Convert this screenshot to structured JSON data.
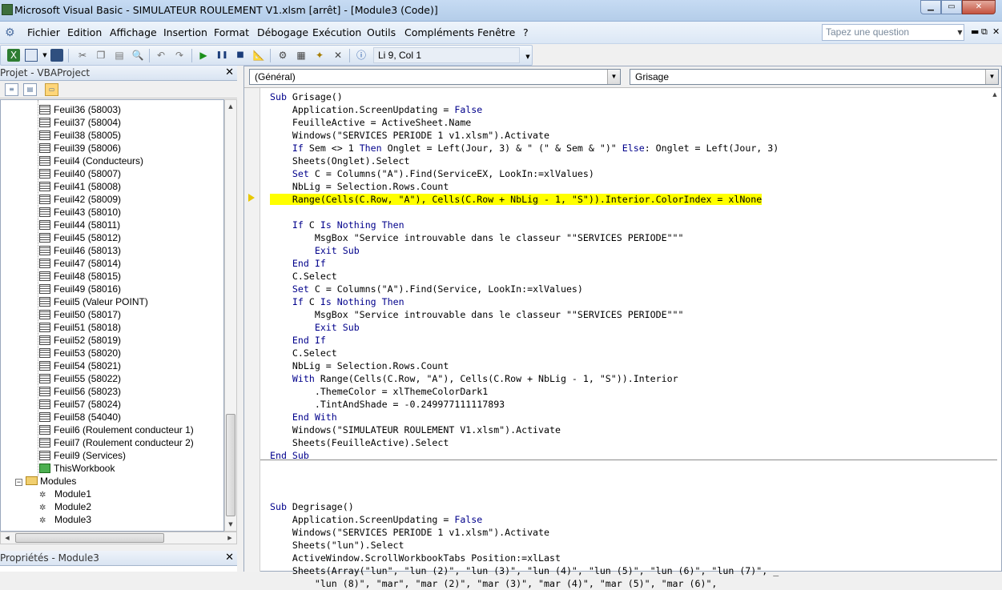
{
  "window": {
    "title": "Microsoft Visual Basic - SIMULATEUR ROULEMENT V1.xlsm [arrêt] - [Module3 (Code)]",
    "min_glyph": "▁",
    "max_glyph": "▭",
    "close_glyph": "✕"
  },
  "menu": {
    "items": [
      "Fichier",
      "Edition",
      "Affichage",
      "Insertion",
      "Format",
      "Débogage",
      "Exécution",
      "Outils",
      "Compléments",
      "Fenêtre",
      "?"
    ],
    "ask_placeholder": "Tapez une question",
    "mdi_min": "▬",
    "mdi_restore": "⧉",
    "mdi_close": "✕"
  },
  "toolbar": {
    "position_label": "Li 9, Col 1",
    "icons": [
      "excel-icon",
      "insert-userform-icon",
      "save-icon",
      "cut-icon",
      "copy-icon",
      "paste-icon",
      "find-icon",
      "undo-icon",
      "redo-icon",
      "run-icon",
      "break-icon",
      "reset-icon",
      "design-mode-icon",
      "project-explorer-icon",
      "properties-icon",
      "object-browser-icon",
      "toolbox-icon",
      "help-icon"
    ]
  },
  "project_panel": {
    "title": "Projet - VBAProject",
    "close_label": "✕",
    "sheets": [
      "Feuil36 (58003)",
      "Feuil37 (58004)",
      "Feuil38 (58005)",
      "Feuil39 (58006)",
      "Feuil4 (Conducteurs)",
      "Feuil40 (58007)",
      "Feuil41 (58008)",
      "Feuil42 (58009)",
      "Feuil43 (58010)",
      "Feuil44 (58011)",
      "Feuil45 (58012)",
      "Feuil46 (58013)",
      "Feuil47 (58014)",
      "Feuil48 (58015)",
      "Feuil49 (58016)",
      "Feuil5 (Valeur POINT)",
      "Feuil50 (58017)",
      "Feuil51 (58018)",
      "Feuil52 (58019)",
      "Feuil53 (58020)",
      "Feuil54 (58021)",
      "Feuil55 (58022)",
      "Feuil56 (58023)",
      "Feuil57 (58024)",
      "Feuil58 (54040)",
      "Feuil6 (Roulement conducteur 1)",
      "Feuil7 (Roulement conducteur 2)",
      "Feuil9 (Services)"
    ],
    "workbook": "ThisWorkbook",
    "modules_folder": "Modules",
    "modules": [
      "Module1",
      "Module2",
      "Module3"
    ]
  },
  "properties_panel": {
    "title": "Propriétés - Module3",
    "close_label": "✕"
  },
  "code_window": {
    "object_combo": "(Général)",
    "procedure_combo": "Grisage",
    "highlighted_line_index": 8,
    "lines": [
      "Sub Grisage()",
      "    Application.ScreenUpdating = False",
      "    FeuilleActive = ActiveSheet.Name",
      "    Windows(\"SERVICES PERIODE 1 v1.xlsm\").Activate",
      "    If Sem <> 1 Then Onglet = Left(Jour, 3) & \" (\" & Sem & \")\" Else: Onglet = Left(Jour, 3)",
      "    Sheets(Onglet).Select",
      "    Set C = Columns(\"A\").Find(ServiceEX, LookIn:=xlValues)",
      "    NbLig = Selection.Rows.Count",
      "    Range(Cells(C.Row, \"A\"), Cells(C.Row + NbLig - 1, \"S\")).Interior.ColorIndex = xlNone",
      "",
      "    If C Is Nothing Then",
      "        MsgBox \"Service introuvable dans le classeur \"\"SERVICES PERIODE\"\"\"",
      "        Exit Sub",
      "    End If",
      "    C.Select",
      "    Set C = Columns(\"A\").Find(Service, LookIn:=xlValues)",
      "    If C Is Nothing Then",
      "        MsgBox \"Service introuvable dans le classeur \"\"SERVICES PERIODE\"\"\"",
      "        Exit Sub",
      "    End If",
      "    C.Select",
      "    NbLig = Selection.Rows.Count",
      "    With Range(Cells(C.Row, \"A\"), Cells(C.Row + NbLig - 1, \"S\")).Interior",
      "        .ThemeColor = xlThemeColorDark1",
      "        .TintAndShade = -0.249977111117893",
      "    End With",
      "    Windows(\"SIMULATEUR ROULEMENT V1.xlsm\").Activate",
      "    Sheets(FeuilleActive).Select",
      "End Sub",
      "",
      "",
      "",
      "Sub Degrisage()",
      "    Application.ScreenUpdating = False",
      "    Windows(\"SERVICES PERIODE 1 v1.xlsm\").Activate",
      "    Sheets(\"lun\").Select",
      "    ActiveWindow.ScrollWorkbookTabs Position:=xlLast",
      "    Sheets(Array(\"lun\", \"lun (2)\", \"lun (3)\", \"lun (4)\", \"lun (5)\", \"lun (6)\", \"lun (7)\", _",
      "        \"lun (8)\", \"mar\", \"mar (2)\", \"mar (3)\", \"mar (4)\", \"mar (5)\", \"mar (6)\","
    ],
    "keywords": [
      "Sub",
      "End Sub",
      "If",
      "Then",
      "Else",
      "Set",
      "Is",
      "Nothing",
      "End If",
      "Exit Sub",
      "With",
      "End With",
      "False"
    ]
  },
  "colors": {
    "keyword": "#00008b",
    "highlight": "#ffff00",
    "exec_arrow": "#e8c800"
  }
}
